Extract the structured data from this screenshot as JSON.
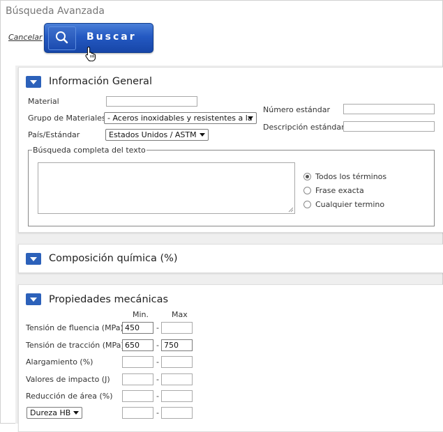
{
  "header": {
    "title": "Búsqueda Avanzada",
    "cancel_label": "Cancelar",
    "search_label": "Buscar"
  },
  "general": {
    "title": "Información General",
    "material_label": "Material",
    "material_value": "",
    "group_label": "Grupo de Materiales",
    "group_value": "- Aceros inoxidables y resistentes a la",
    "country_label": "País/Estándar",
    "country_value": "Estados Unidos / ASTM",
    "std_number_label": "Número estándar",
    "std_number_value": "",
    "std_desc_label": "Descripción estándar",
    "std_desc_value": "",
    "fulltext_legend": "Búsqueda completa del texto",
    "fulltext_value": "",
    "radios": [
      {
        "label": "Todos los términos",
        "checked": true
      },
      {
        "label": "Frase exacta",
        "checked": false
      },
      {
        "label": "Cualquier termino",
        "checked": false
      }
    ]
  },
  "composition": {
    "title": "Composición química (%)"
  },
  "mechanical": {
    "title": "Propiedades mecánicas",
    "min_header": "Min.",
    "max_header": "Max",
    "rows": [
      {
        "label": "Tensión de fluencia (MPa)",
        "min": "450",
        "max": ""
      },
      {
        "label": "Tensión de tracción (MPa)",
        "min": "650",
        "max": "750"
      },
      {
        "label": "Alargamiento (%)",
        "min": "",
        "max": ""
      },
      {
        "label": "Valores de impacto (J)",
        "min": "",
        "max": ""
      },
      {
        "label": "Reducción de área (%)",
        "min": "",
        "max": ""
      }
    ],
    "hardness_select": "Dureza HB",
    "hardness_min": "",
    "hardness_max": ""
  },
  "colors": {
    "accent": "#2c61ba",
    "button": "#2459c2"
  }
}
